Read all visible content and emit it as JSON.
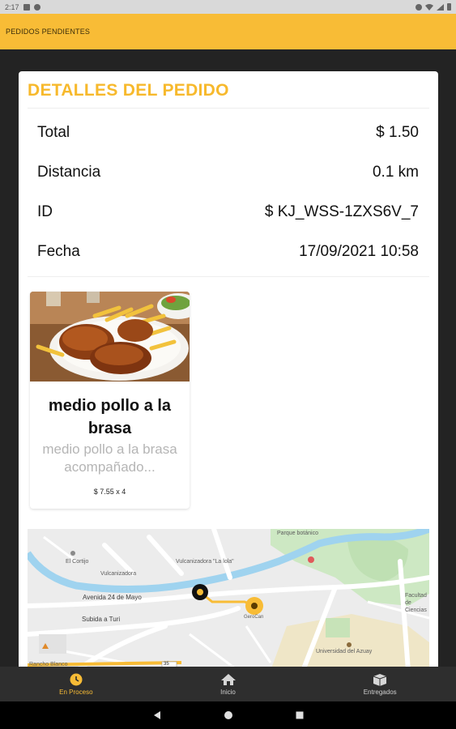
{
  "status_bar": {
    "time": "2:17"
  },
  "app_bar": {
    "title": "PEDIDOS PENDIENTES"
  },
  "details": {
    "title": "DETALLES DEL PEDIDO",
    "rows": [
      {
        "label": "Total",
        "value": "$ 1.50"
      },
      {
        "label": "Distancia",
        "value": "0.1 km"
      },
      {
        "label": "ID",
        "value": "$ KJ_WSS-1ZXS6V_7"
      },
      {
        "label": "Fecha",
        "value": "17/09/2021 10:58"
      }
    ]
  },
  "product": {
    "name": "medio pollo a la brasa",
    "description": "medio pollo a la brasa acompañado...",
    "price_qty": "$ 7.55 x 4"
  },
  "map": {
    "labels": {
      "parque": "Parque botánico",
      "el_cortijo": "El Cortijo",
      "vulcanizadora_lalola": "Vulcanizadora \"La lola\"",
      "vulcanizadora": "Vulcanizadora",
      "avenida": "Avenida 24 de Mayo",
      "subida": "Subida a Turi",
      "facultad": "Facultad de Ciencias",
      "universidad": "Universidad del Azuay",
      "rancho": "Rancho Blanco",
      "road_sign": "35",
      "gerocan": "GeroCan"
    }
  },
  "bottom_nav": {
    "items": [
      {
        "label": "En Proceso",
        "icon": "clock-icon",
        "active": true
      },
      {
        "label": "Inicio",
        "icon": "home-icon",
        "active": false
      },
      {
        "label": "Entregados",
        "icon": "box-icon",
        "active": false
      }
    ]
  },
  "colors": {
    "accent": "#f8bc36",
    "title": "#f7b92c"
  }
}
